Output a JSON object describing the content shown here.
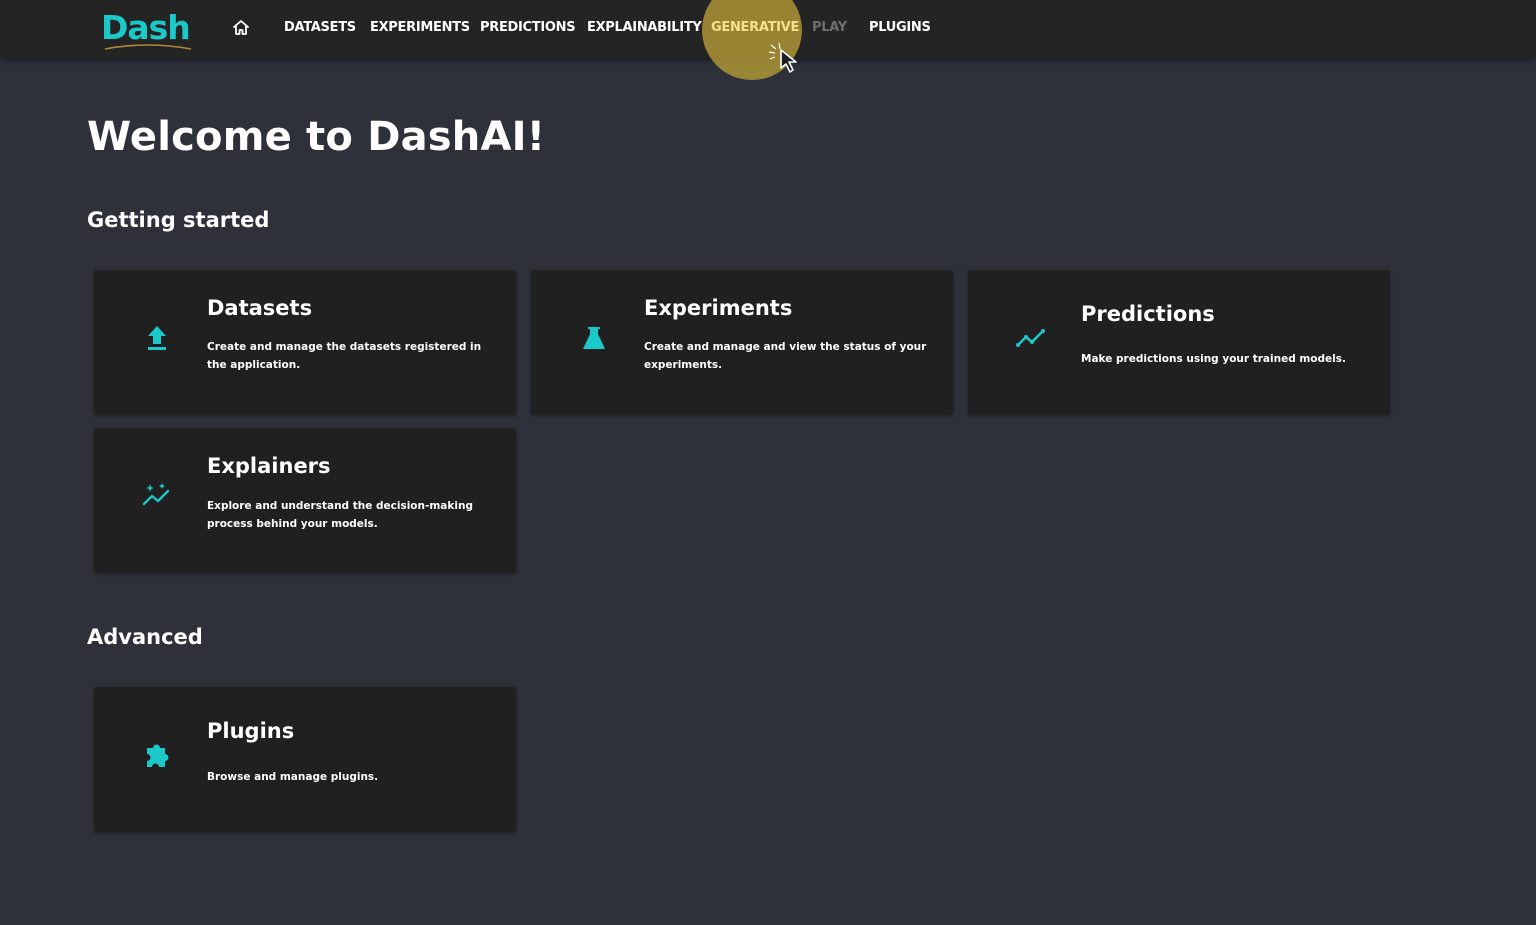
{
  "header": {
    "logo_text": "Dash",
    "home_icon": "home-icon",
    "nav": [
      {
        "label": "DATASETS",
        "state": "normal"
      },
      {
        "label": "EXPERIMENTS",
        "state": "normal"
      },
      {
        "label": "PREDICTIONS",
        "state": "normal"
      },
      {
        "label": "EXPLAINABILITY",
        "state": "normal"
      },
      {
        "label": "GENERATIVE",
        "state": "active"
      },
      {
        "label": "PLAY",
        "state": "disabled"
      },
      {
        "label": "PLUGINS",
        "state": "normal"
      }
    ]
  },
  "main": {
    "welcome": "Welcome to DashAI!",
    "getting_started": {
      "heading": "Getting started",
      "cards": [
        {
          "title": "Datasets",
          "description": "Create and manage the datasets registered in the application.",
          "icon": "upload-icon"
        },
        {
          "title": "Experiments",
          "description": "Create and manage and view the status of your experiments.",
          "icon": "flask-icon"
        },
        {
          "title": "Predictions",
          "description": "Make predictions using your trained models.",
          "icon": "trending-line-icon"
        },
        {
          "title": "Explainers",
          "description": "Explore and understand the decision-making process behind your models.",
          "icon": "sparkle-chart-icon"
        }
      ]
    },
    "advanced": {
      "heading": "Advanced",
      "cards": [
        {
          "title": "Plugins",
          "description": "Browse and manage plugins.",
          "icon": "puzzle-icon"
        }
      ]
    }
  },
  "colors": {
    "accent": "#1bc9c9",
    "background": "#2e303a",
    "topbar": "#242424",
    "card": "#202020",
    "highlight": "#c4a836"
  }
}
